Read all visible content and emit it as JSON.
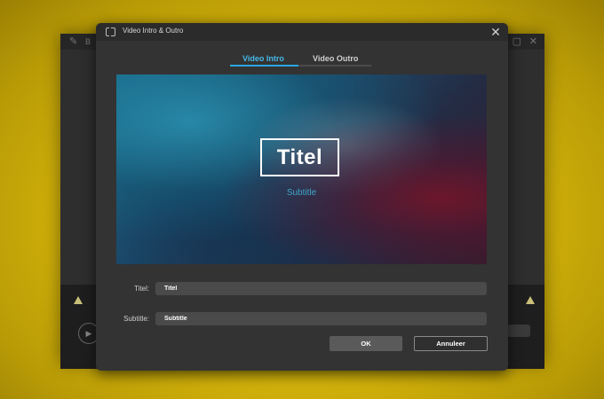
{
  "dialog": {
    "title": "Video Intro & Outro",
    "tabs": [
      {
        "label": "Video Intro",
        "active": true
      },
      {
        "label": "Video Outro",
        "active": false
      }
    ],
    "preview": {
      "title_text": "Titel",
      "subtitle_text": "Subtitle"
    },
    "fields": {
      "title": {
        "label": "Titel:",
        "value": "Titel"
      },
      "subtitle": {
        "label": "Subtitle:",
        "value": "Subtitle"
      }
    },
    "buttons": {
      "ok": "OK",
      "cancel": "Annuleer"
    }
  },
  "colors": {
    "accent": "#2aa8e0",
    "dialog_bg": "#333333",
    "page_bg": "#d8b80c"
  },
  "icons": {
    "close": "close-icon",
    "title": "film-icon"
  }
}
